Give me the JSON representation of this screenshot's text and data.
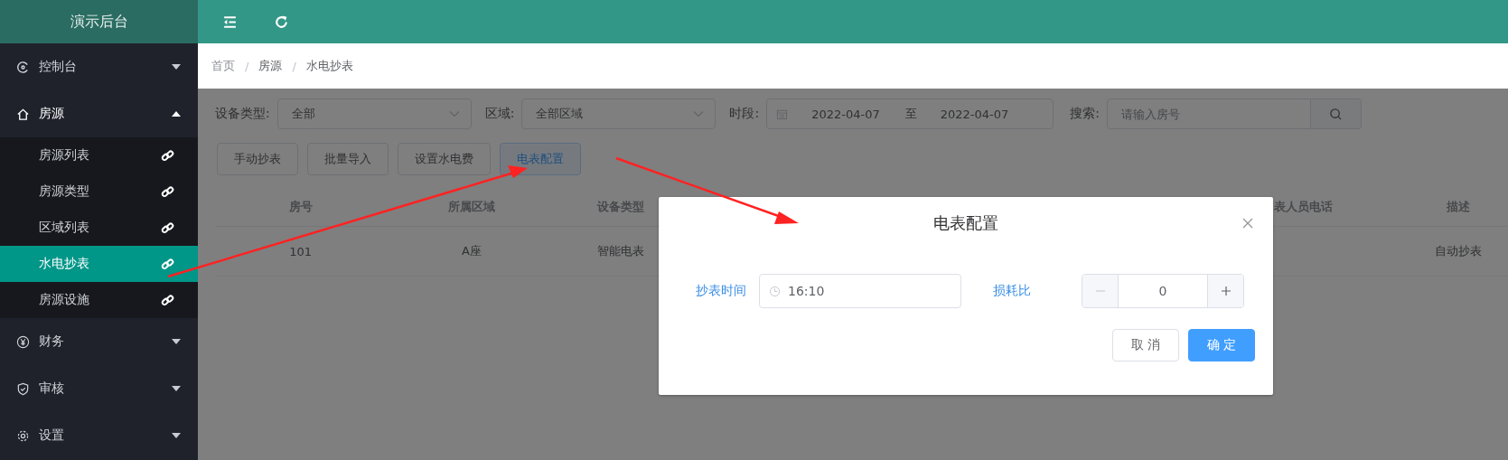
{
  "app_title": "演示后台",
  "sidebar": {
    "items": [
      {
        "label": "控制台",
        "expanded": false
      },
      {
        "label": "房源",
        "expanded": true,
        "children": [
          {
            "label": "房源列表",
            "selected": false
          },
          {
            "label": "房源类型",
            "selected": false
          },
          {
            "label": "区域列表",
            "selected": false
          },
          {
            "label": "水电抄表",
            "selected": true
          },
          {
            "label": "房源设施",
            "selected": false
          }
        ]
      },
      {
        "label": "财务",
        "expanded": false
      },
      {
        "label": "审核",
        "expanded": false
      },
      {
        "label": "设置",
        "expanded": false
      }
    ]
  },
  "breadcrumb": {
    "separator": "/",
    "items": [
      "首页",
      "房源",
      "水电抄表"
    ]
  },
  "filters": {
    "device_type": {
      "label": "设备类型:",
      "value": "全部"
    },
    "area": {
      "label": "区域:",
      "value": "全部区域"
    },
    "period": {
      "label": "时段:",
      "start": "2022-04-07",
      "separator": "至",
      "end": "2022-04-07"
    },
    "search": {
      "label": "搜索:",
      "placeholder": "请输入房号"
    }
  },
  "actions": [
    {
      "label": "手动抄表",
      "kind": "default"
    },
    {
      "label": "批量导入",
      "kind": "default"
    },
    {
      "label": "设置水电费",
      "kind": "default"
    },
    {
      "label": "电表配置",
      "kind": "primary-plain"
    }
  ],
  "table": {
    "columns": [
      "房号",
      "所属区域",
      "设备类型",
      "表人员电话",
      "描述"
    ],
    "rows": [
      [
        "101",
        "A座",
        "智能电表",
        "",
        "自动抄表"
      ]
    ]
  },
  "dialog": {
    "title": "电表配置",
    "time_label": "抄表时间",
    "time_value": "16:10",
    "ratio_label": "损耗比",
    "ratio_value": "0",
    "cancel": "取 消",
    "confirm": "确 定"
  }
}
